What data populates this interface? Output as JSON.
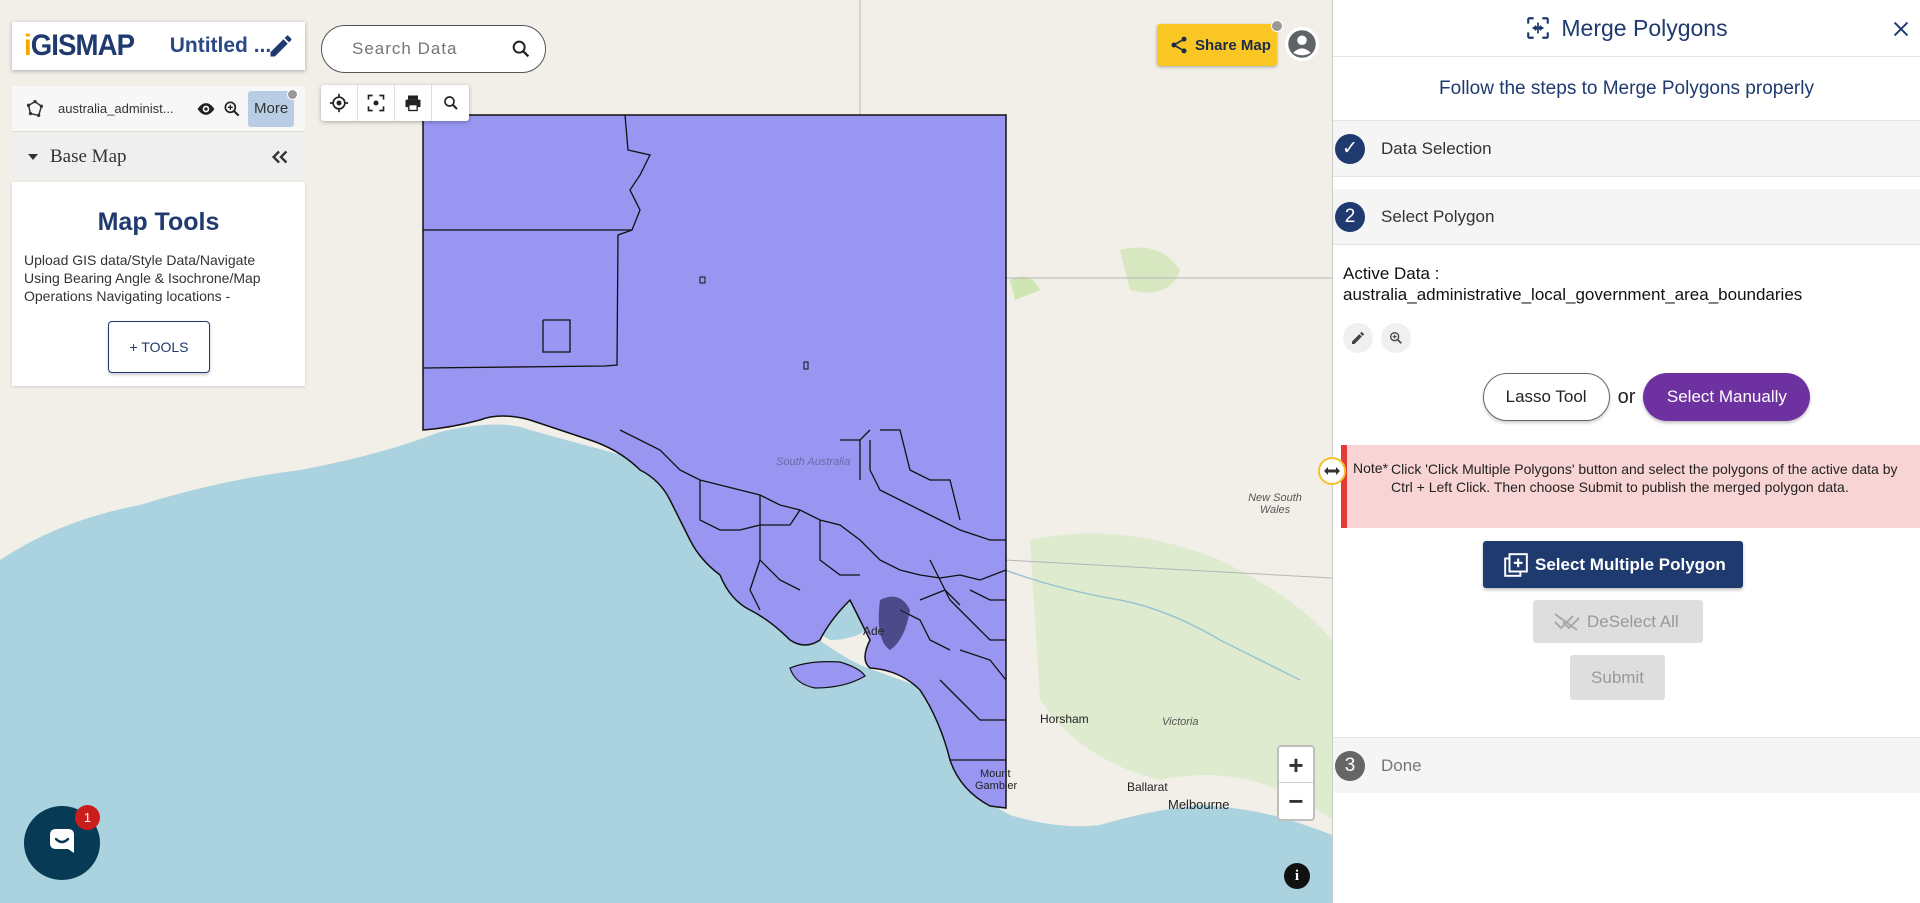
{
  "header": {
    "logo_prefix": "i",
    "logo_rest": "GISMAP",
    "map_title": "Untitled ...",
    "search_placeholder": "Search Data"
  },
  "layer": {
    "name": "australia_administ...",
    "more_label": "More"
  },
  "basemap": {
    "label": "Base Map"
  },
  "map_tools": {
    "title": "Map Tools",
    "description": "Upload GIS data/Style Data/Navigate Using Bearing Angle & Isochrone/Map Operations Navigating locations -",
    "button_label": "+ TOOLS"
  },
  "share": {
    "label": "Share Map"
  },
  "map_labels": {
    "state_sa": "South Australia",
    "state_nsw": "New South Wales",
    "victoria": "Victoria",
    "horsham": "Horsham",
    "ballarat": "Ballarat",
    "melbourne": "Melbourne",
    "adelaide": "Ade",
    "mount": "Mount",
    "gambier": "Gambier"
  },
  "zoom": {
    "in": "+",
    "out": "−"
  },
  "info": "i",
  "chat": {
    "badge": "1"
  },
  "panel": {
    "title": "Merge Polygons",
    "subtitle": "Follow the steps to Merge Polygons properly",
    "steps": [
      {
        "num": "✓",
        "label": "Data Selection"
      },
      {
        "num": "2",
        "label": "Select Polygon"
      },
      {
        "num": "3",
        "label": "Done"
      }
    ],
    "active_data_label": "Active Data :",
    "active_data_value": "australia_administrative_local_government_area_boundaries",
    "lasso_label": "Lasso Tool",
    "or_label": "or",
    "manual_label": "Select Manually",
    "note_tag": "Note*",
    "note_text": "Click 'Click Multiple Polygons' button and select the polygons of the active data by Ctrl + Left Click. Then choose Submit to publish the merged polygon data.",
    "multi_label": "Select Multiple Polygon",
    "deselect_label": "DeSelect All",
    "submit_label": "Submit"
  },
  "colors": {
    "brand": "#1f3a6e",
    "accent_purple": "#6e31a0",
    "share_yellow": "#f9c623",
    "polygon_fill": "#9896f1",
    "sea": "#aad3df"
  }
}
